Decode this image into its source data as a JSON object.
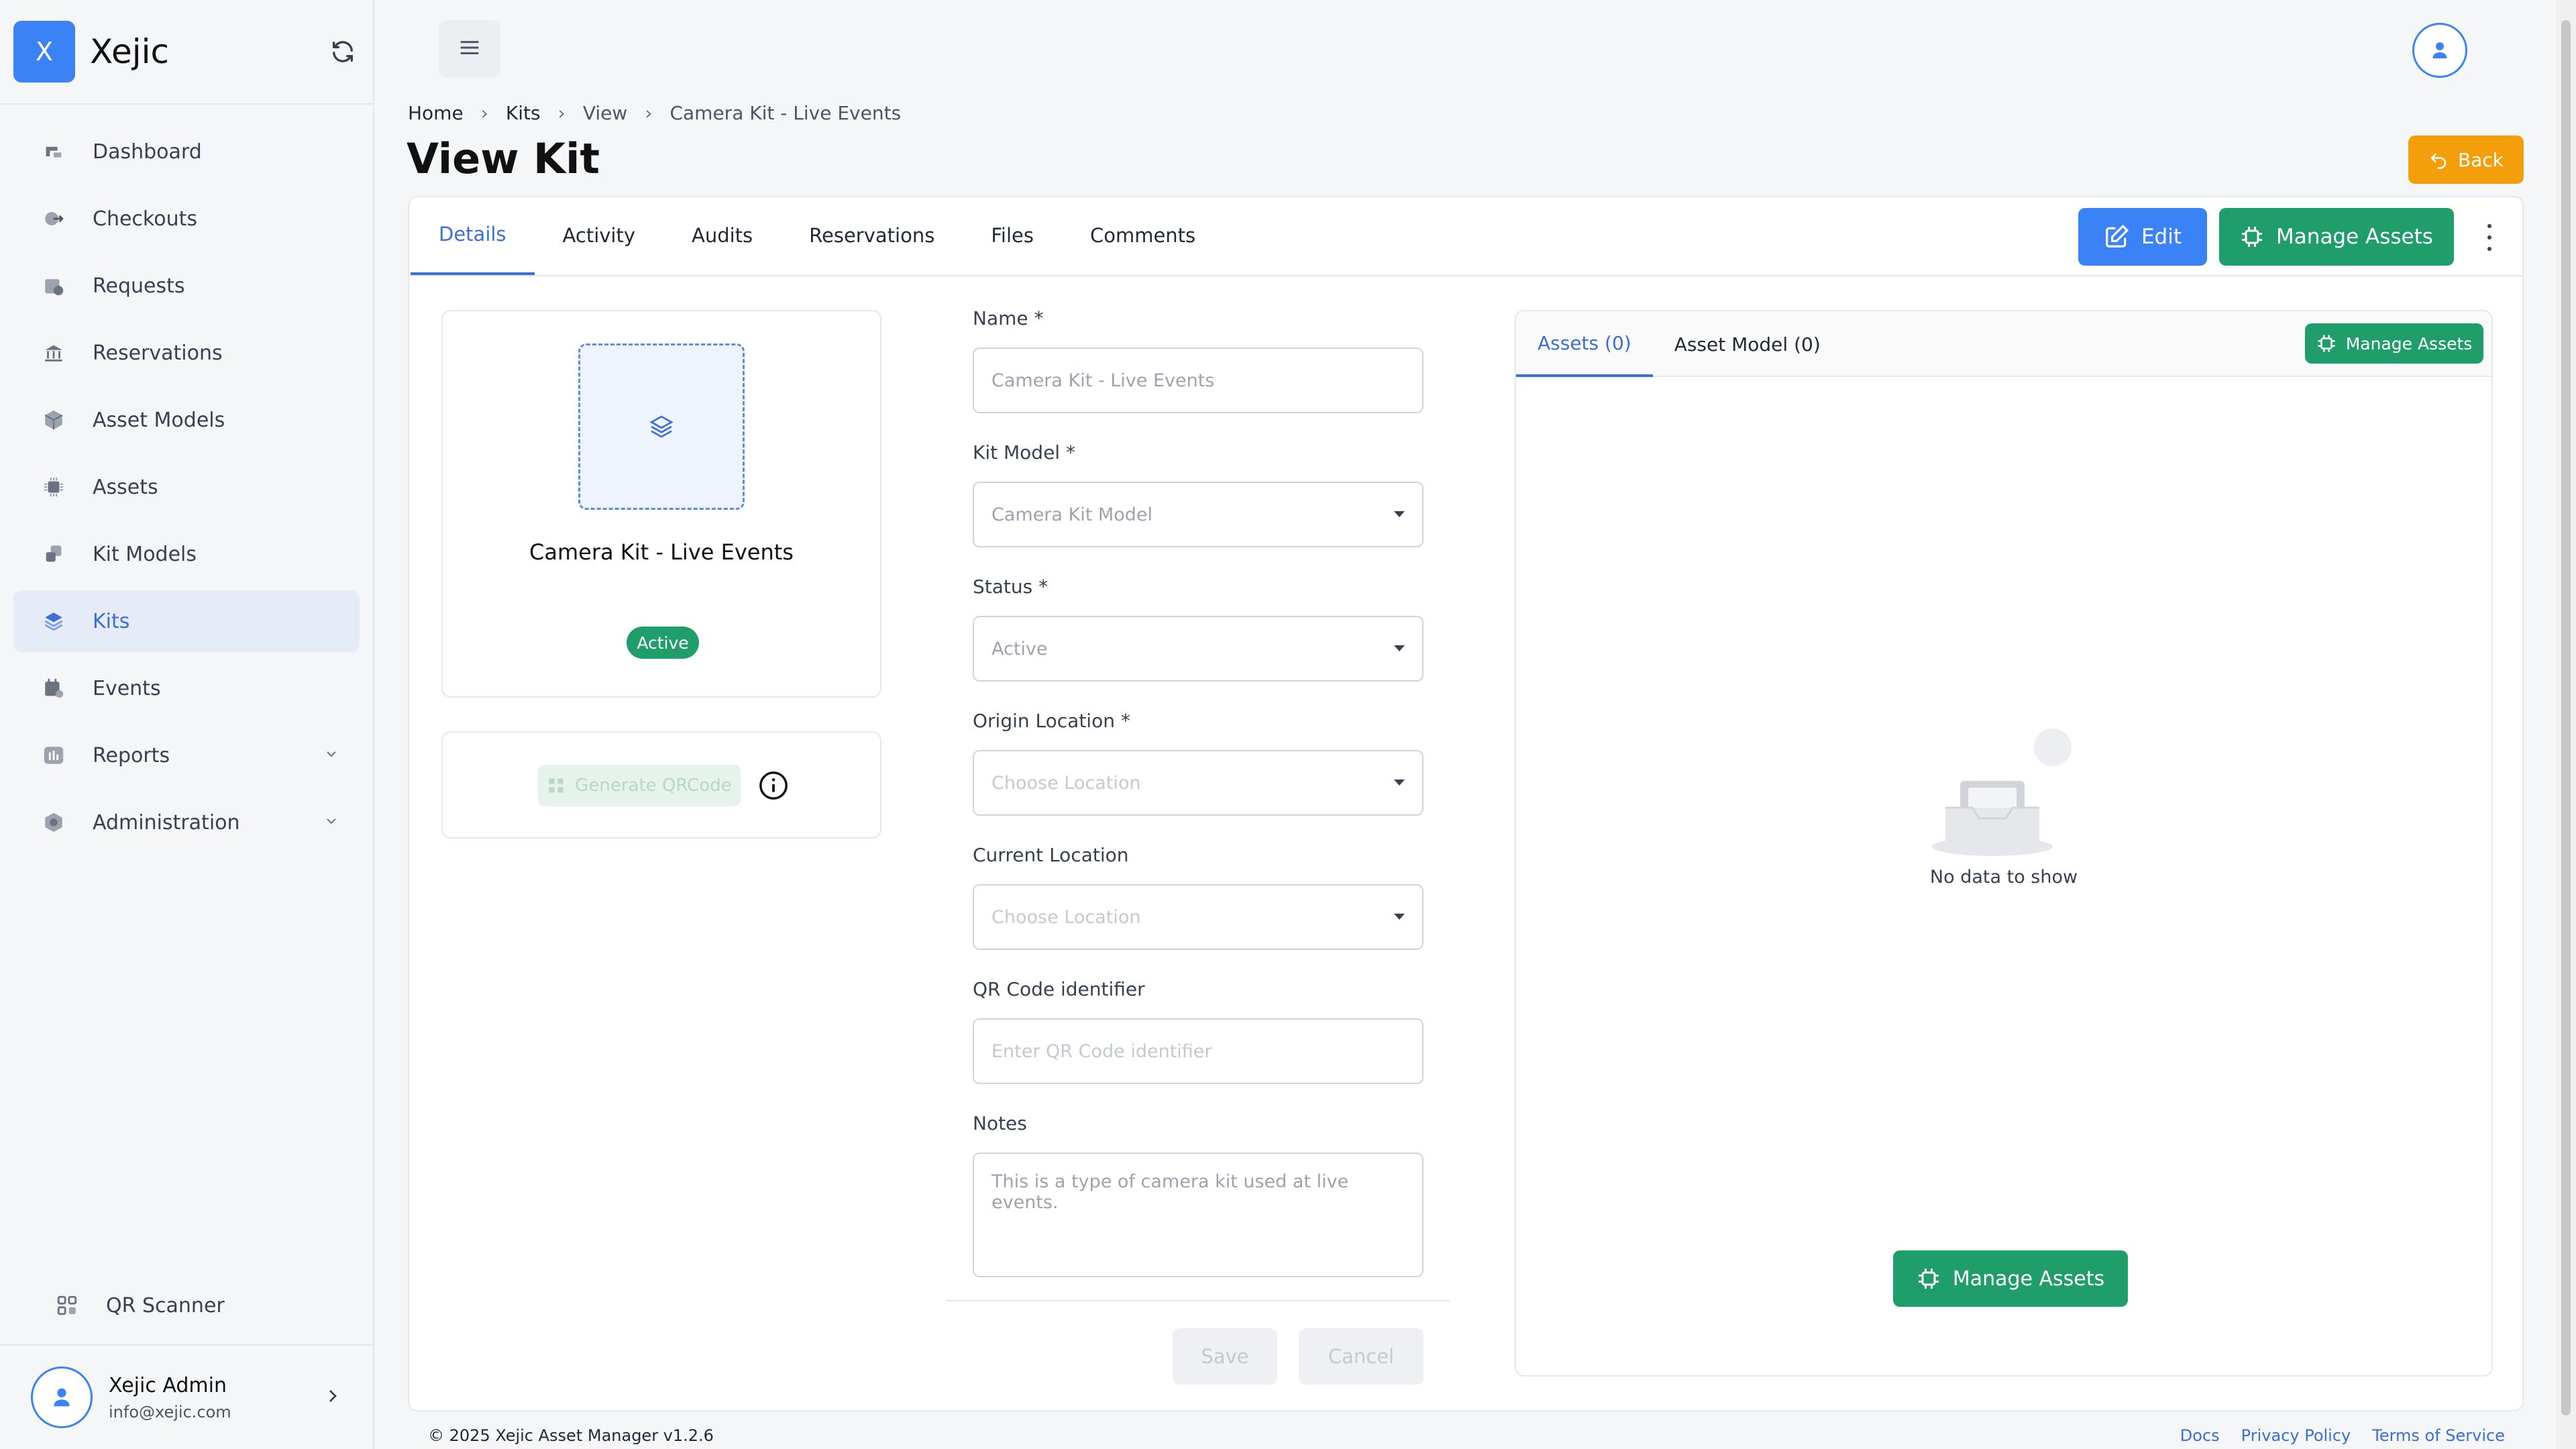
{
  "app": {
    "logo_letter": "X",
    "name": "Xejic"
  },
  "sidebar": {
    "items": [
      {
        "label": "Dashboard",
        "icon": "dashboard-icon"
      },
      {
        "label": "Checkouts",
        "icon": "checkout-icon"
      },
      {
        "label": "Requests",
        "icon": "requests-icon"
      },
      {
        "label": "Reservations",
        "icon": "reservations-icon"
      },
      {
        "label": "Asset Models",
        "icon": "cube-icon"
      },
      {
        "label": "Assets",
        "icon": "chip-icon"
      },
      {
        "label": "Kit Models",
        "icon": "kit-models-icon"
      },
      {
        "label": "Kits",
        "icon": "layers-icon",
        "active": true
      },
      {
        "label": "Events",
        "icon": "calendar-icon"
      },
      {
        "label": "Reports",
        "icon": "reports-icon",
        "expandable": true
      },
      {
        "label": "Administration",
        "icon": "admin-icon",
        "expandable": true
      }
    ],
    "qr_scanner": "QR Scanner",
    "user": {
      "name": "Xejic Admin",
      "email": "info@xejic.com"
    }
  },
  "breadcrumb": [
    "Home",
    "Kits",
    "View",
    "Camera Kit - Live Events"
  ],
  "page_title": "View Kit",
  "back_label": "Back",
  "tabs": [
    "Details",
    "Activity",
    "Audits",
    "Reservations",
    "Files",
    "Comments"
  ],
  "actions": {
    "edit": "Edit",
    "manage_assets": "Manage Assets"
  },
  "kit": {
    "name": "Camera Kit - Live Events",
    "status": "Active"
  },
  "qr": {
    "generate_label": "Generate QRCode"
  },
  "form": {
    "name_label": "Name *",
    "name_value": "Camera Kit - Live Events",
    "kit_model_label": "Kit Model *",
    "kit_model_value": "Camera Kit Model",
    "status_label": "Status *",
    "status_value": "Active",
    "origin_label": "Origin Location *",
    "origin_placeholder": "Choose Location",
    "current_label": "Current Location",
    "current_placeholder": "Choose Location",
    "qr_label": "QR Code identifier",
    "qr_placeholder": "Enter QR Code identifier",
    "notes_label": "Notes",
    "notes_value": "This is a type of camera kit used at live events.",
    "save": "Save",
    "cancel": "Cancel"
  },
  "assets_panel": {
    "tab_assets": "Assets (0)",
    "tab_asset_model": "Asset Model (0)",
    "manage_assets": "Manage Assets",
    "empty_text": "No data to show"
  },
  "footer": {
    "copyright": "© 2025 Xejic Asset Manager v1.2.6",
    "links": [
      "Docs",
      "Privacy Policy",
      "Terms of Service"
    ]
  },
  "colors": {
    "primary": "#3b82f6",
    "success": "#1f9d6b",
    "warning": "#f59e0b"
  }
}
